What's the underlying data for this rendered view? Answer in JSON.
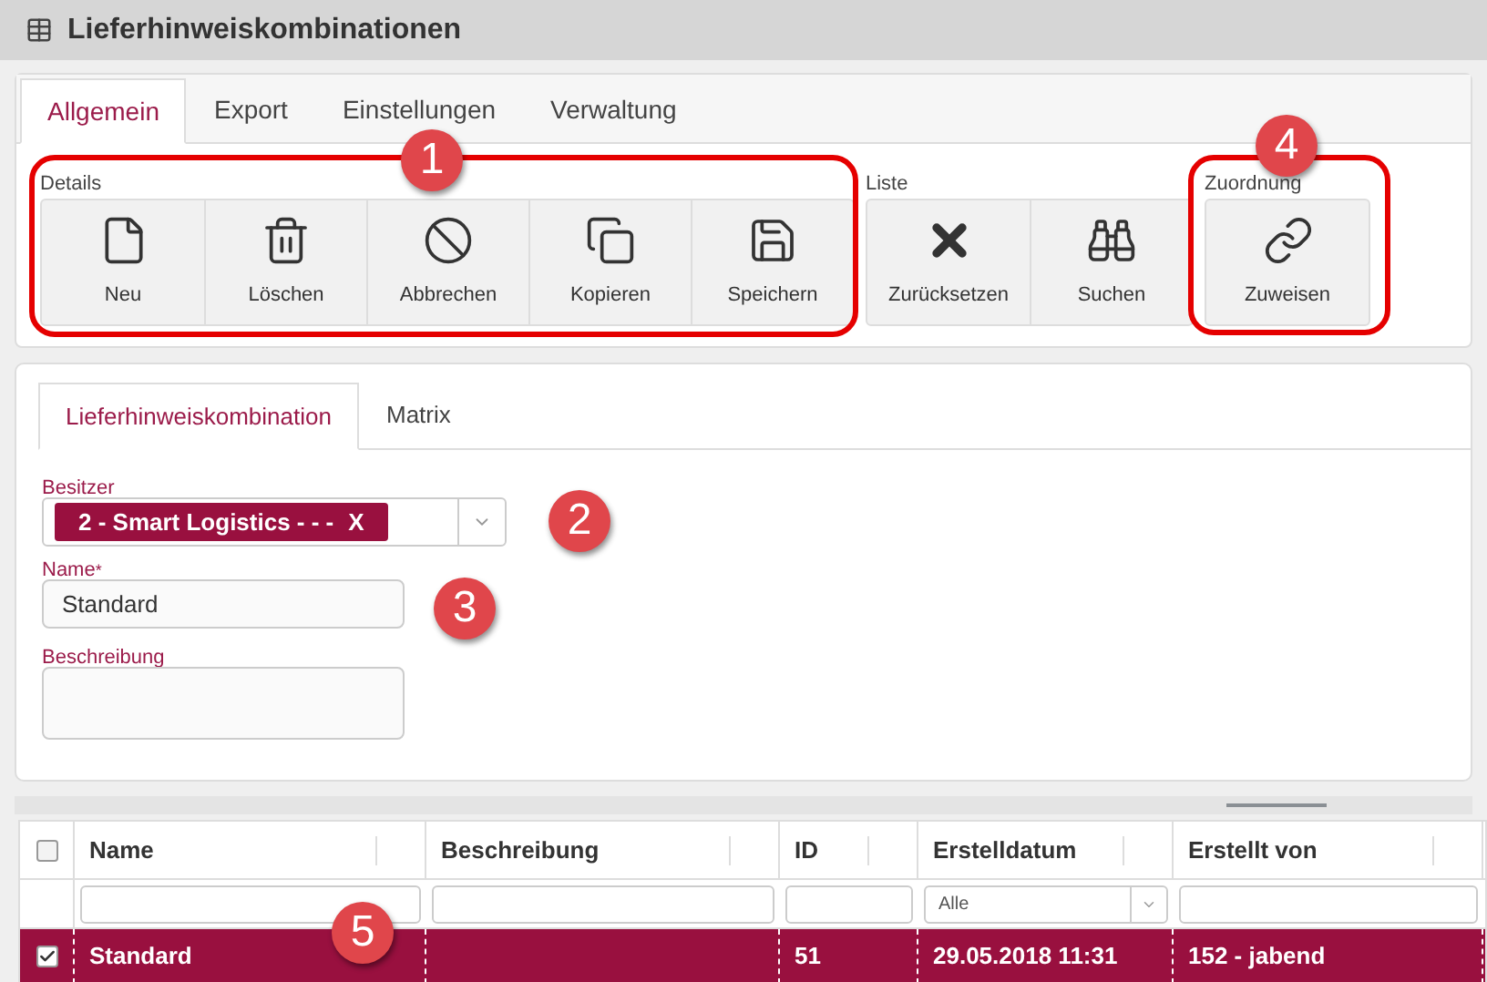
{
  "window": {
    "title": "Lieferhinweiskombinationen"
  },
  "tabs": [
    {
      "label": "Allgemein",
      "selected": true
    },
    {
      "label": "Export",
      "selected": false
    },
    {
      "label": "Einstellungen",
      "selected": false
    },
    {
      "label": "Verwaltung",
      "selected": false
    }
  ],
  "toolbar_groups": [
    {
      "label": "Details",
      "buttons": [
        {
          "label": "Neu",
          "kind": "new"
        },
        {
          "label": "Löschen",
          "kind": "delete"
        },
        {
          "label": "Abbrechen",
          "kind": "cancel"
        },
        {
          "label": "Kopieren",
          "kind": "copy"
        },
        {
          "label": "Speichern",
          "kind": "save"
        }
      ]
    },
    {
      "label": "Liste",
      "buttons": [
        {
          "label": "Zurücksetzen",
          "kind": "reset"
        },
        {
          "label": "Suchen",
          "kind": "search"
        }
      ]
    },
    {
      "label": "Zuordnung",
      "buttons": [
        {
          "label": "Zuweisen",
          "kind": "assign"
        }
      ]
    }
  ],
  "detail_tabs": [
    {
      "label": "Lieferhinweiskombination",
      "selected": true
    },
    {
      "label": "Matrix",
      "selected": false
    }
  ],
  "form": {
    "owner": {
      "label": "Besitzer",
      "tag": "2 - Smart Logistics - - -",
      "remove": "X"
    },
    "name": {
      "label": "Name",
      "required_mark": "*",
      "value": "Standard"
    },
    "description": {
      "label": "Beschreibung"
    }
  },
  "grid": {
    "header_checked": false,
    "columns": [
      "Name",
      "Beschreibung",
      "ID",
      "Erstelldatum",
      "Erstellt von"
    ],
    "filters": [
      {
        "kind": "text"
      },
      {
        "kind": "text"
      },
      {
        "kind": "text"
      },
      {
        "kind": "select",
        "value": "Alle"
      },
      {
        "kind": "text"
      }
    ],
    "rows": [
      {
        "selected": true,
        "checked": true,
        "cells": [
          "Standard",
          "",
          "51",
          "29.05.2018 11:31",
          "152 - jabend"
        ]
      }
    ]
  },
  "annotations": [
    {
      "number": "1",
      "outline": true
    },
    {
      "number": "2",
      "outline": false
    },
    {
      "number": "3",
      "outline": false
    },
    {
      "number": "4",
      "outline": true
    },
    {
      "number": "5",
      "outline": false
    }
  ]
}
